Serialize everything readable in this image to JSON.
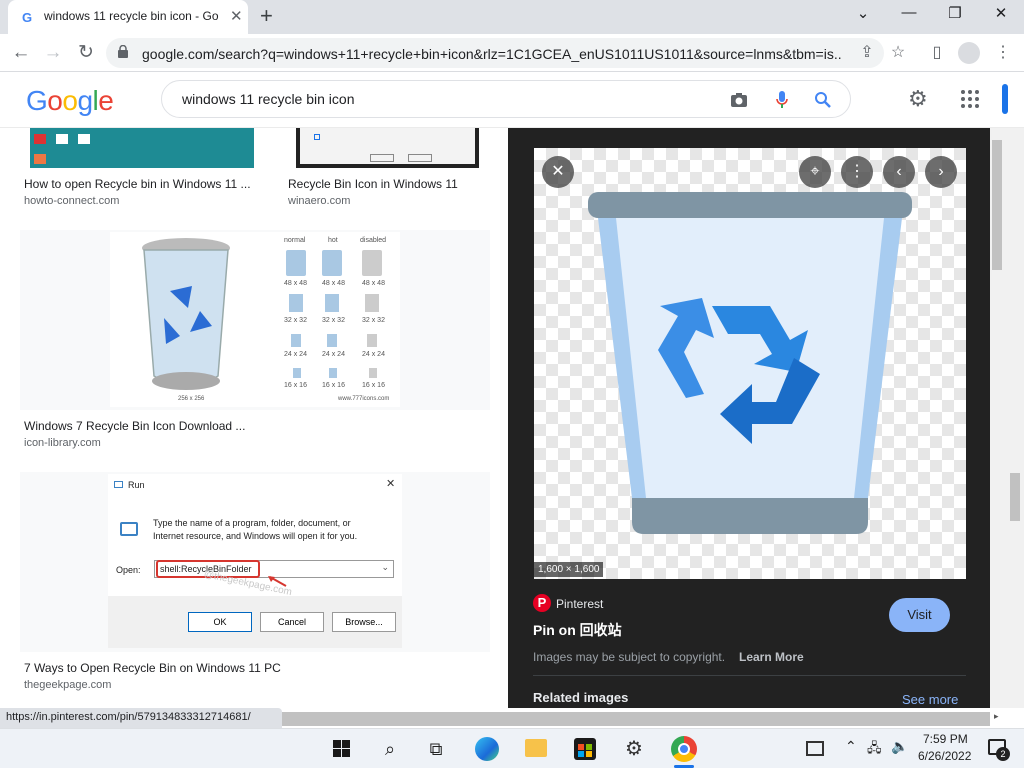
{
  "browser": {
    "tab_title": "windows 11 recycle bin icon - Go",
    "tab_favicon": "G",
    "new_tab": "+",
    "url": "google.com/search?q=windows+11+recycle+bin+icon&rlz=1C1GCEA_enUS1011US1011&source=lnms&tbm=is...",
    "status_url": "https://in.pinterest.com/pin/579134833312714681/"
  },
  "google": {
    "logo_letters": [
      {
        "ch": "G",
        "color": "#4285f4"
      },
      {
        "ch": "o",
        "color": "#ea4335"
      },
      {
        "ch": "o",
        "color": "#fbbc05"
      },
      {
        "ch": "g",
        "color": "#4285f4"
      },
      {
        "ch": "l",
        "color": "#34a853"
      },
      {
        "ch": "e",
        "color": "#ea4335"
      }
    ],
    "query": "windows 11 recycle bin icon"
  },
  "results": [
    {
      "caption": "How to open Recycle bin in Windows 11 ...",
      "domain": "howto-connect.com"
    },
    {
      "caption": "Recycle Bin Icon in Windows 11",
      "domain": "winaero.com"
    },
    {
      "caption": "Windows 7 Recycle Bin Icon Download ...",
      "domain": "icon-library.com"
    },
    {
      "caption": "7 Ways to Open Recycle Bin on Windows 11 PC",
      "domain": "thegeekpage.com"
    }
  ],
  "w7grid": {
    "headers": [
      "normal",
      "hot",
      "disabled"
    ],
    "sizes": [
      "48 x 48",
      "32 x 32",
      "24 x 24",
      "16 x 16"
    ],
    "footer_left": "256 x 256",
    "footer_right": "www.777icons.com"
  },
  "run_dialog": {
    "title": "Run",
    "text_line1": "Type the name of a program, folder, document, or",
    "text_line2": "Internet resource, and Windows will open it for you.",
    "open_label": "Open:",
    "value": "shell:RecycleBinFolder",
    "ok": "OK",
    "cancel": "Cancel",
    "browse": "Browse...",
    "watermark": "@thegeekpage.com"
  },
  "preview": {
    "dimensions": "1,600 × 1,600",
    "source": "Pinterest",
    "title": "Pin on 回收站",
    "visit": "Visit",
    "copyright_text": "Images may be subject to copyright.",
    "learn_more": "Learn More",
    "related": "Related images",
    "see_more": "See more"
  },
  "taskbar": {
    "time": "7:59 PM",
    "date": "6/26/2022",
    "notif_count": "2"
  }
}
